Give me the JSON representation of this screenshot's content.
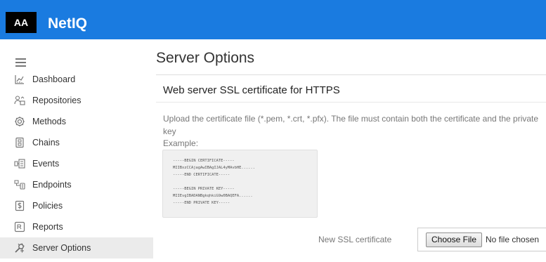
{
  "header": {
    "logo_text": "AA",
    "app_title": "NetIQ",
    "accent_color": "#1a7be0"
  },
  "sidebar": {
    "menu_icon": "hamburger-icon",
    "items": [
      {
        "label": "Dashboard",
        "icon": "dashboard-icon"
      },
      {
        "label": "Repositories",
        "icon": "repositories-icon"
      },
      {
        "label": "Methods",
        "icon": "methods-icon"
      },
      {
        "label": "Chains",
        "icon": "chains-icon"
      },
      {
        "label": "Events",
        "icon": "events-icon"
      },
      {
        "label": "Endpoints",
        "icon": "endpoints-icon"
      },
      {
        "label": "Policies",
        "icon": "policies-icon"
      },
      {
        "label": "Reports",
        "icon": "reports-icon"
      },
      {
        "label": "Server Options",
        "icon": "server-options-icon",
        "active": true
      }
    ]
  },
  "main": {
    "page_title": "Server Options",
    "section_title": "Web server SSL certificate for HTTPS",
    "help_text": "Upload the certificate file (*.pem, *.crt, *.pfx). The file must contain both the certificate and the private key",
    "example_label": "Example:",
    "example_lines": [
      "-----BEGIN CERTIFICATE-----",
      "MIIBxzCCAjagAwIBAgIJAL4yMAvbHE......",
      "-----END CERTIFICATE-----",
      "",
      "-----BEGIN PRIVATE KEY-----",
      "MIIEvgIBADANBgkqhkiG9w0BAQEFA......",
      "-----END PRIVATE KEY-----"
    ],
    "ssl_field_label": "New SSL certificate",
    "choose_file_label": "Choose File",
    "no_file_text": "No file chosen"
  }
}
